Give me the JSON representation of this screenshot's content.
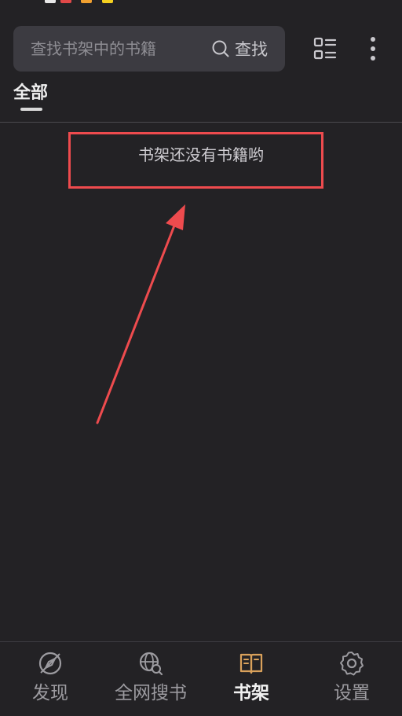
{
  "colors": {
    "background": "#232225",
    "search_bg": "#3c3b41",
    "annotation_red": "#ee4b4e",
    "active_icon": "#d9a15b",
    "inactive": "#9c9ba0"
  },
  "search": {
    "placeholder": "查找书架中的书籍",
    "button_label": "查找",
    "icon": "search-icon"
  },
  "toolbar": {
    "layout_icon": "list-layout-icon",
    "more_icon": "more-vertical-icon"
  },
  "tabs": [
    {
      "label": "全部",
      "active": true
    }
  ],
  "empty_state": {
    "message": "书架还没有书籍哟"
  },
  "bottom_nav": [
    {
      "label": "发现",
      "icon": "compass-icon",
      "active": false
    },
    {
      "label": "全网搜书",
      "icon": "globe-search-icon",
      "active": false
    },
    {
      "label": "书架",
      "icon": "book-icon",
      "active": true
    },
    {
      "label": "设置",
      "icon": "gear-icon",
      "active": false
    }
  ]
}
